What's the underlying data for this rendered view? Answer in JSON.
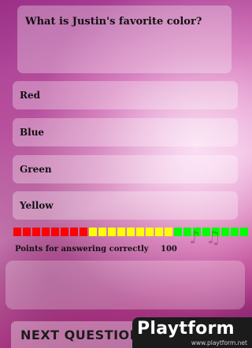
{
  "question": "What is Justin's favorite color?",
  "answers": [
    "Red",
    "Blue",
    "Green",
    "Yellow"
  ],
  "meter": {
    "colors": [
      "#ff0000",
      "#ff0000",
      "#ff0000",
      "#ff0000",
      "#ff0000",
      "#ff0000",
      "#ff0000",
      "#ff0000",
      "#ffff00",
      "#ffff00",
      "#ffff00",
      "#ffff00",
      "#ffff00",
      "#ffff00",
      "#ffff00",
      "#ffff00",
      "#ffff00",
      "#00ff00",
      "#00ff00",
      "#00ff00",
      "#00ff00",
      "#00ff00",
      "#00ff00",
      "#00ff00",
      "#00ff00"
    ]
  },
  "points": {
    "label": "Points for answering correctly",
    "value": "100"
  },
  "next_label": "NEXT QUESTION",
  "brand": {
    "name": "Playtform",
    "url": "www.playtform.net"
  }
}
